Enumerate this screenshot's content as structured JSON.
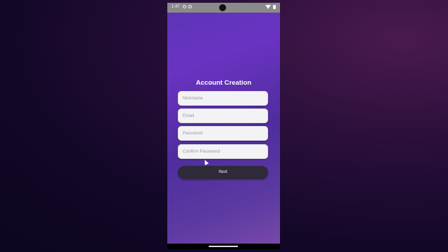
{
  "status_bar": {
    "time": "1:47"
  },
  "form": {
    "title": "Account Creation",
    "nickname_placeholder": "Nickname",
    "email_placeholder": "Email",
    "password_placeholder": "Password",
    "confirm_password_placeholder": "Confirm Password",
    "next_label": "Next"
  },
  "colors": {
    "accent_purple": "#6a33c2",
    "button_dark": "#2f2a3a"
  }
}
